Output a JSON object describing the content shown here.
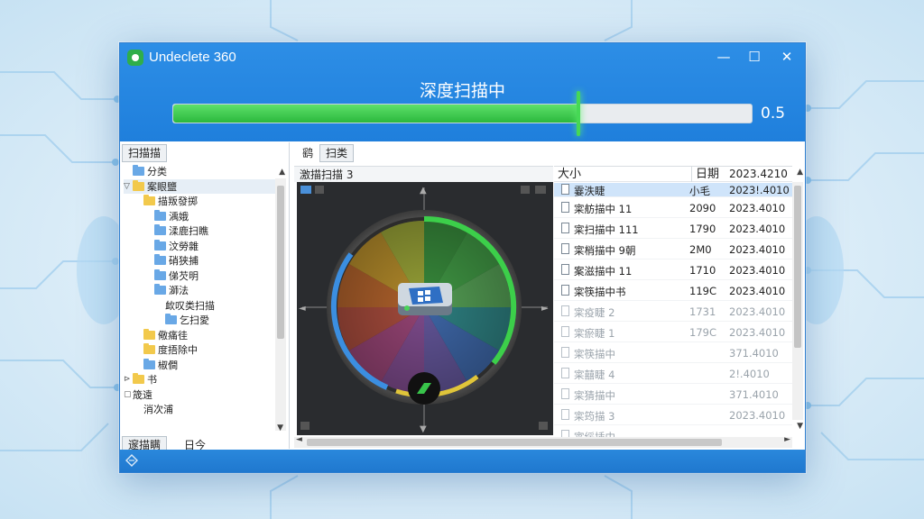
{
  "window": {
    "app_title": "Undeclete 360",
    "scan_title": "深度扫描中",
    "progress_fraction": 0.7,
    "progress_value": "0.5",
    "minimize": "—",
    "maximize": "☐",
    "close": "✕"
  },
  "left_pane": {
    "tab_label": "扫描描",
    "tree": [
      {
        "label": "分类",
        "icon": "folder-blue",
        "level": 0,
        "expander": ""
      },
      {
        "label": "案眼鹽",
        "icon": "folder-yellow",
        "level": 0,
        "expander": "▽"
      },
      {
        "label": "描叛發掷",
        "icon": "folder-yellow",
        "level": 1,
        "expander": ""
      },
      {
        "label": "渪娥",
        "icon": "folder-blue",
        "level": 2,
        "expander": ""
      },
      {
        "label": "渘鹿扫瞧",
        "icon": "folder-blue",
        "level": 2,
        "expander": ""
      },
      {
        "label": "汶勞雜",
        "icon": "folder-blue",
        "level": 2,
        "expander": ""
      },
      {
        "label": "硝狭捕",
        "icon": "folder-blue",
        "level": 2,
        "expander": ""
      },
      {
        "label": "俤芡明",
        "icon": "folder-blue",
        "level": 2,
        "expander": ""
      },
      {
        "label": "溮法",
        "icon": "folder-blue",
        "level": 2,
        "expander": ""
      },
      {
        "label": "欰叹类扫描",
        "icon": "none",
        "level": 3,
        "expander": ""
      },
      {
        "label": "乞扫愛",
        "icon": "folder-blue",
        "level": 3,
        "expander": ""
      },
      {
        "label": "儆痛徍",
        "icon": "folder-yellow",
        "level": 1,
        "expander": ""
      },
      {
        "label": "度捂除中",
        "icon": "folder-yellow",
        "level": 1,
        "expander": ""
      },
      {
        "label": "椒僴",
        "icon": "folder-blue",
        "level": 1,
        "expander": ""
      },
      {
        "label": "书",
        "icon": "folder-yellow",
        "level": 0,
        "expander": "⊳"
      },
      {
        "label": "筬遠",
        "icon": "none",
        "level": 0,
        "expander": "▢"
      },
      {
        "label": "消次浦",
        "icon": "none",
        "level": 1,
        "expander": ""
      }
    ],
    "bottom_tabs": [
      "邃描瞒",
      "日今"
    ]
  },
  "middle_pane": {
    "tabs": [
      "鹞",
      "扫类"
    ],
    "header_label": "激描扫描 3"
  },
  "list_pane": {
    "columns": [
      "大小",
      "日期"
    ],
    "sort_date_header": "2023.4210",
    "rows": [
      {
        "name": "霎泆睫",
        "size": "小毛",
        "date": "2023!.4010",
        "selected": true,
        "faded": false
      },
      {
        "name": "寀舫描中 11",
        "size": "2090",
        "date": "2023.4010",
        "selected": false,
        "faded": false
      },
      {
        "name": "寀扫描中 111",
        "size": "1790",
        "date": "2023.4010",
        "selected": false,
        "faded": false
      },
      {
        "name": "寀梢描中 9朝",
        "size": "2M0",
        "date": "2023.4010",
        "selected": false,
        "faded": false
      },
      {
        "name": "案滋描中 11",
        "size": "1710",
        "date": "2023.4010",
        "selected": false,
        "faded": false
      },
      {
        "name": "寀筷描中书",
        "size": "119C",
        "date": "2023.4010",
        "selected": false,
        "faded": false
      },
      {
        "name": "寀疫睫 2",
        "size": "1731",
        "date": "2023.4010",
        "selected": false,
        "faded": true
      },
      {
        "name": "寀瘀睫 1",
        "size": "179C",
        "date": "2023.4010",
        "selected": false,
        "faded": true
      },
      {
        "name": "寀筷描中",
        "size": "",
        "date": "371.4010",
        "selected": false,
        "faded": true
      },
      {
        "name": "寀囍睫 4",
        "size": "",
        "date": "2!.4010",
        "selected": false,
        "faded": true
      },
      {
        "name": "寀猜描中",
        "size": "",
        "date": "371.4010",
        "selected": false,
        "faded": true
      },
      {
        "name": "寀筠描 3",
        "size": "",
        "date": "2023.4010",
        "selected": false,
        "faded": true
      },
      {
        "name": "寀绥插中",
        "size": "",
        "date": "",
        "selected": false,
        "faded": true
      }
    ]
  },
  "colors": {
    "titlebar": "#1f7fdc",
    "progress_green": "#2bb83d",
    "selection": "#cfe4fa",
    "wheel_segments": [
      "#3a9a3e",
      "#43a848",
      "#5bb05a",
      "#2e8d8e",
      "#3f6fb8",
      "#6a5aa8",
      "#8a4f9a",
      "#a5477e",
      "#b8503e",
      "#c46a2c",
      "#c99a2a",
      "#a8b438"
    ]
  }
}
